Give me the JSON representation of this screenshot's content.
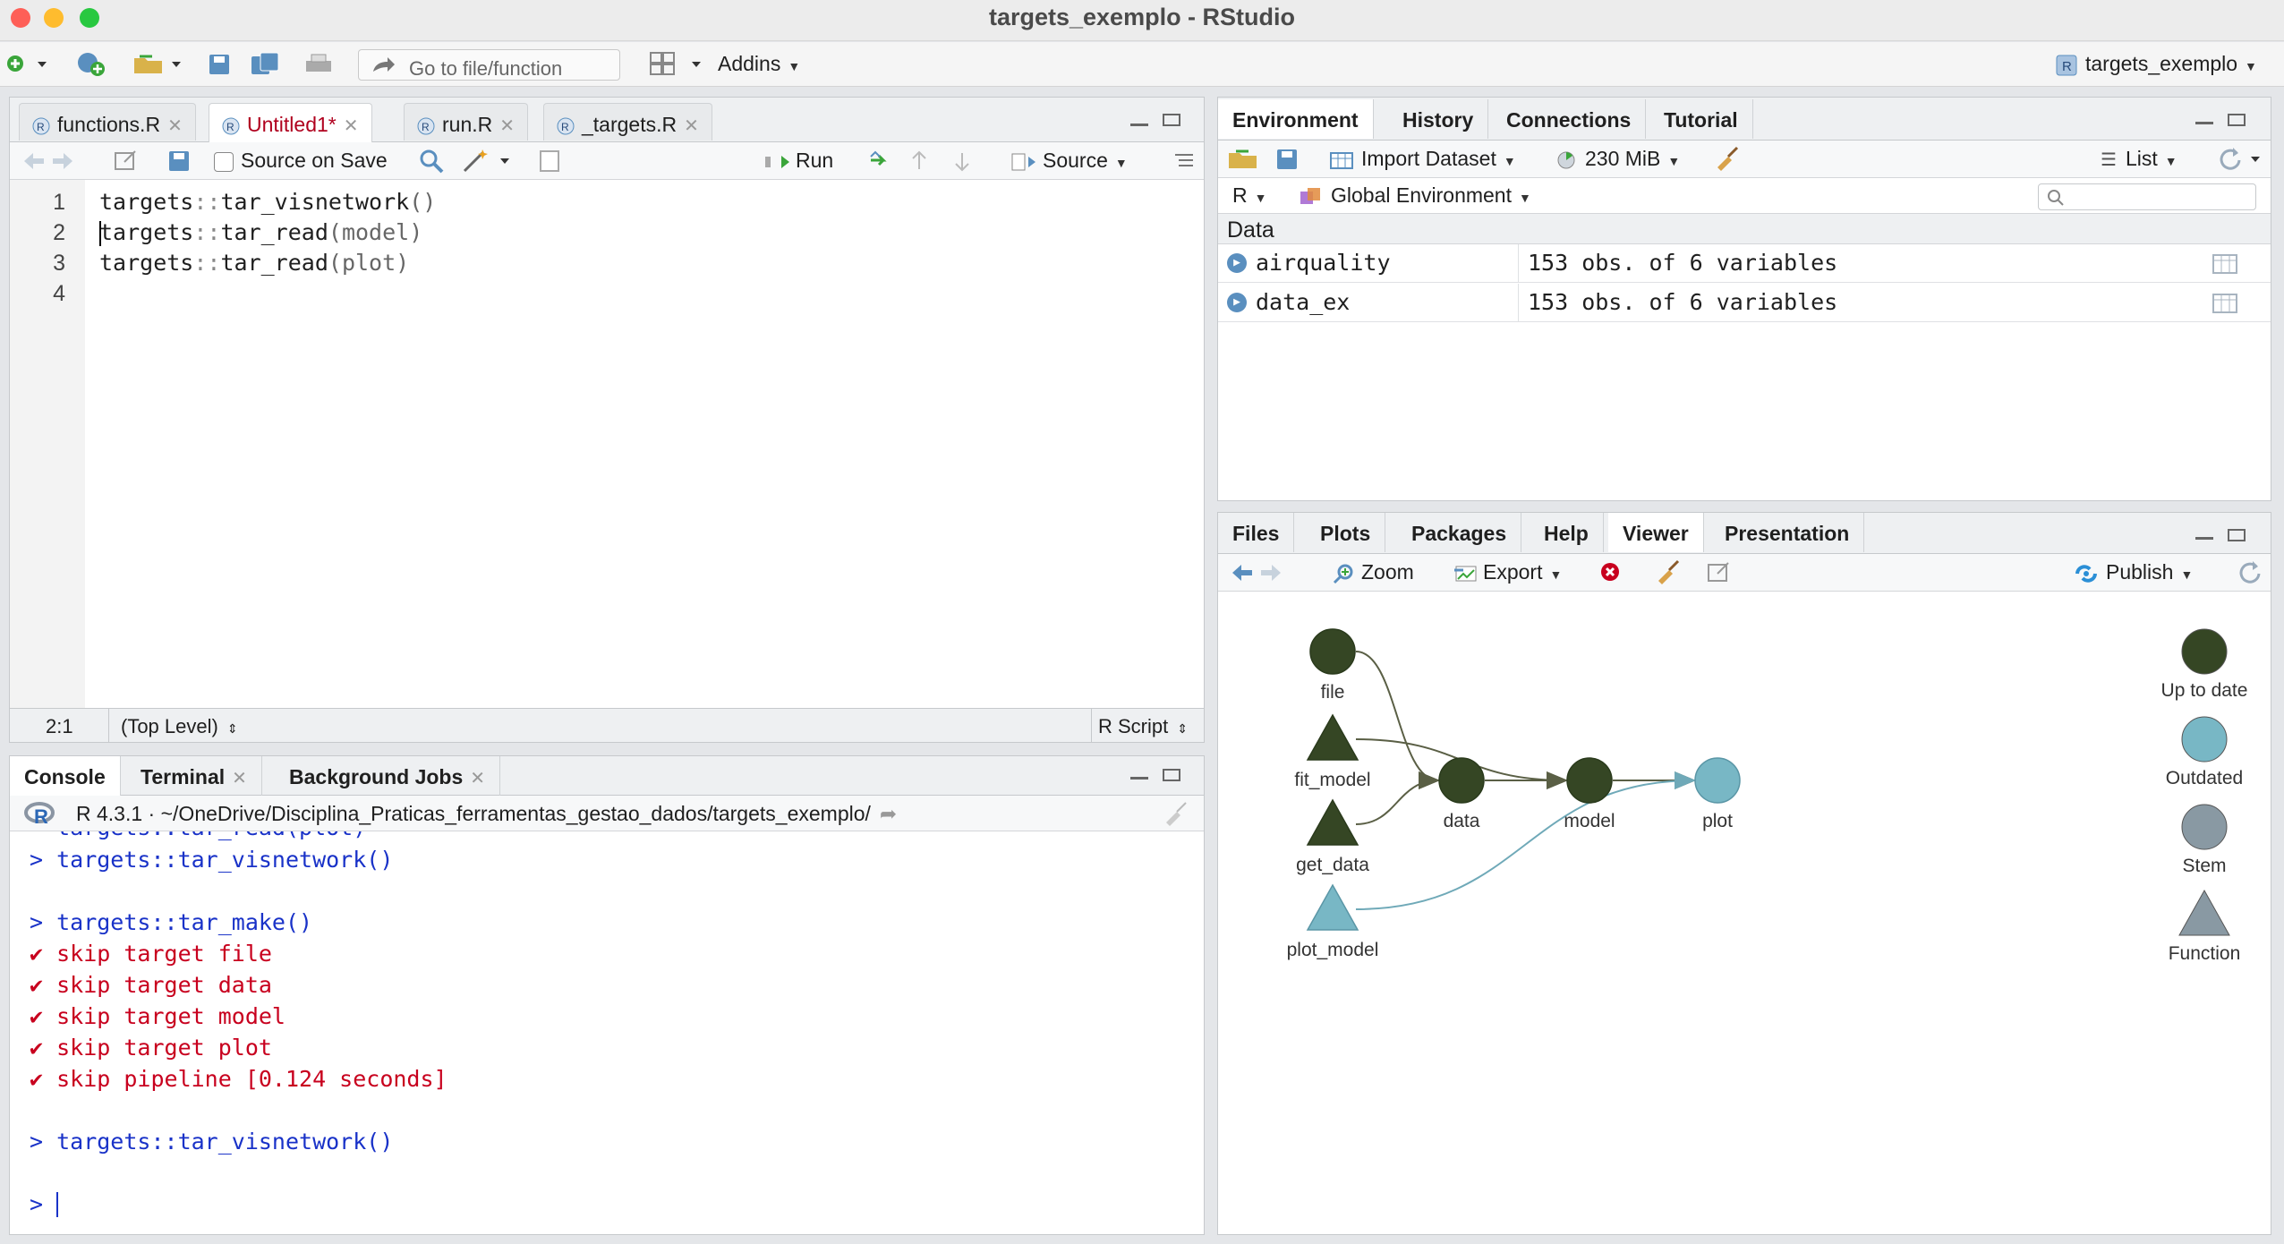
{
  "window": {
    "title": "targets_exemplo - RStudio"
  },
  "main_toolbar": {
    "goto_placeholder": "Go to file/function",
    "addins_label": "Addins",
    "project_label": "targets_exemplo"
  },
  "source_pane": {
    "tabs": [
      {
        "label": "functions.R",
        "active": false
      },
      {
        "label": "Untitled1*",
        "active": true
      },
      {
        "label": "run.R",
        "active": false
      },
      {
        "label": "_targets.R",
        "active": false
      }
    ],
    "source_on_save": "Source on Save",
    "run_label": "Run",
    "source_label": "Source",
    "line_numbers": [
      "1",
      "2",
      "3",
      "4"
    ],
    "code": [
      {
        "pkg": "targets",
        "sep": "::",
        "fn": "tar_visnetwork",
        "args": "()"
      },
      {
        "pkg": "targets",
        "sep": "::",
        "fn": "tar_read",
        "args": "(model)"
      },
      {
        "pkg": "targets",
        "sep": "::",
        "fn": "tar_read",
        "args": "(plot)"
      }
    ],
    "cursor_pos": "2:1",
    "scope": "(Top Level)",
    "file_type": "R Script"
  },
  "console_pane": {
    "tabs": [
      {
        "label": "Console",
        "active": true
      },
      {
        "label": "Terminal",
        "active": false
      },
      {
        "label": "Background Jobs",
        "active": false
      }
    ],
    "r_version": "R 4.3.1",
    "path": "~/OneDrive/Disciplina_Praticas_ferramentas_gestao_dados/targets_exemplo/",
    "lines": [
      {
        "text": "> targets::tar_visnetwork()",
        "style": "blue"
      },
      {
        "text": "",
        "style": "blue"
      },
      {
        "text": "> targets::tar_make()",
        "style": "blue"
      },
      {
        "text": "✔ skip target file",
        "style": "red"
      },
      {
        "text": "✔ skip target data",
        "style": "red"
      },
      {
        "text": "✔ skip target model",
        "style": "red"
      },
      {
        "text": "✔ skip target plot",
        "style": "red"
      },
      {
        "text": "✔ skip pipeline [0.124 seconds]",
        "style": "red"
      },
      {
        "text": "",
        "style": "blue"
      },
      {
        "text": "> targets::tar_visnetwork()",
        "style": "blue"
      },
      {
        "text": "",
        "style": "blue"
      },
      {
        "text": ">",
        "style": "blue"
      }
    ]
  },
  "env_pane": {
    "tabs": [
      {
        "label": "Environment",
        "active": true
      },
      {
        "label": "History",
        "active": false
      },
      {
        "label": "Connections",
        "active": false
      },
      {
        "label": "Tutorial",
        "active": false
      }
    ],
    "import_dataset": "Import Dataset",
    "memory": "230 MiB",
    "view_mode": "List",
    "language": "R",
    "scope": "Global Environment",
    "section": "Data",
    "rows": [
      {
        "name": "airquality",
        "value": "153 obs. of 6 variables"
      },
      {
        "name": "data_ex",
        "value": "153 obs. of 6 variables"
      }
    ]
  },
  "viewer_pane": {
    "tabs": [
      {
        "label": "Files",
        "active": false
      },
      {
        "label": "Plots",
        "active": false
      },
      {
        "label": "Packages",
        "active": false
      },
      {
        "label": "Help",
        "active": false
      },
      {
        "label": "Viewer",
        "active": true
      },
      {
        "label": "Presentation",
        "active": false
      }
    ],
    "zoom_label": "Zoom",
    "export_label": "Export",
    "publish_label": "Publish",
    "nodes": [
      {
        "id": "file",
        "label": "file",
        "shape": "circle",
        "status": "up-to-date"
      },
      {
        "id": "fit_model",
        "label": "fit_model",
        "shape": "triangle",
        "status": "up-to-date"
      },
      {
        "id": "get_data",
        "label": "get_data",
        "shape": "triangle",
        "status": "up-to-date"
      },
      {
        "id": "plot_model",
        "label": "plot_model",
        "shape": "triangle",
        "status": "outdated"
      },
      {
        "id": "data",
        "label": "data",
        "shape": "circle",
        "status": "up-to-date"
      },
      {
        "id": "model",
        "label": "model",
        "shape": "circle",
        "status": "up-to-date"
      },
      {
        "id": "plot",
        "label": "plot",
        "shape": "circle",
        "status": "outdated"
      }
    ],
    "edges": [
      [
        "file",
        "data"
      ],
      [
        "get_data",
        "data"
      ],
      [
        "fit_model",
        "model"
      ],
      [
        "data",
        "model"
      ],
      [
        "model",
        "plot"
      ],
      [
        "plot_model",
        "plot"
      ]
    ],
    "legend": [
      {
        "label": "Up to date",
        "shape": "circle",
        "color": "#354624"
      },
      {
        "label": "Outdated",
        "shape": "circle",
        "color": "#78b7c5"
      },
      {
        "label": "Stem",
        "shape": "circle",
        "color": "#8999a3"
      },
      {
        "label": "Function",
        "shape": "triangle",
        "color": "#8999a3"
      }
    ],
    "colors": {
      "up_to_date": "#354624",
      "outdated": "#78b7c5"
    }
  }
}
